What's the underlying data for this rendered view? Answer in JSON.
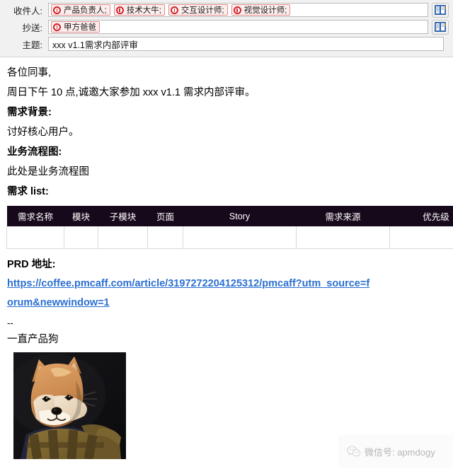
{
  "compose": {
    "to": {
      "label": "收件人:",
      "chips": [
        "产品负责人;",
        "技术大牛;",
        "交互设计师;",
        "视觉设计师;"
      ],
      "icon": "error-circle-icon",
      "addressbook_icon": "address-book-icon"
    },
    "cc": {
      "label": "抄送:",
      "chips": [
        "甲方爸爸"
      ],
      "icon": "error-circle-icon",
      "addressbook_icon": "address-book-icon"
    },
    "subject": {
      "label": "主题:",
      "value": "xxx v1.1需求内部评审",
      "placeholder": ""
    }
  },
  "body": {
    "greeting": "各位同事,",
    "intro": "周日下午 10 点,诚邀大家参加 xxx v1.1 需求内部评审。",
    "heading_background": "需求背景:",
    "background_text": "讨好核心用户。",
    "heading_flow": "业务流程图:",
    "flow_text": "此处是业务流程图",
    "heading_list": "需求 list:",
    "heading_prd": "PRD 地址:",
    "prd_url": "https://coffee.pmcaff.com/article/3197272204125312/pmcaff?utm_source=forum&newwindow=1",
    "separator": "--",
    "signature": "一直产品狗",
    "photo_alt": "shiba-inu-avatar"
  },
  "table": {
    "headers": [
      "需求名称",
      "模块",
      "子模块",
      "页面",
      "Story",
      "需求来源",
      "优先级"
    ],
    "rows": [
      [
        "",
        "",
        "",
        "",
        "",
        "",
        ""
      ]
    ]
  },
  "watermark": {
    "icon": "wechat-icon",
    "text": "微信号: apmdogy"
  },
  "colors": {
    "chip_border": "#e08a8a",
    "chip_bg": "#fdeeee",
    "chip_icon": "#d01f25",
    "table_header_bg": "#17091c",
    "link": "#2a6fd1",
    "header_bg": "#f1f1f1"
  }
}
